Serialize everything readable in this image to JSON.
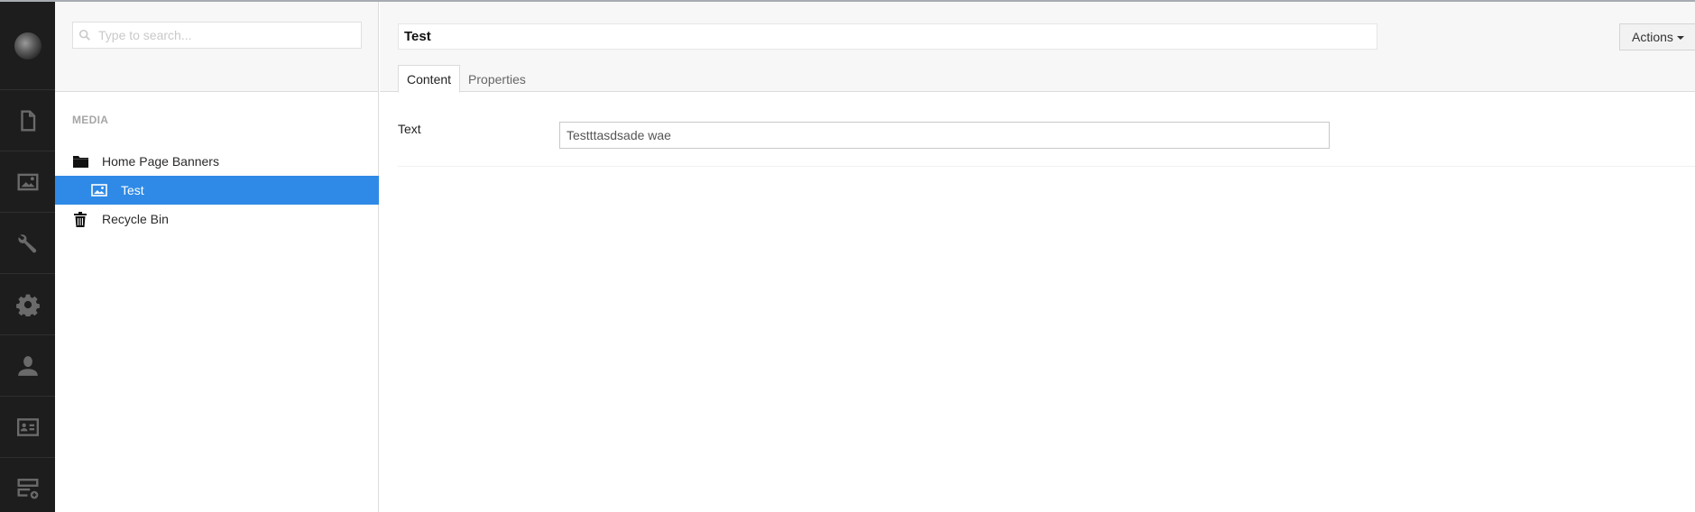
{
  "app_nav": {
    "items": [
      {
        "name": "content",
        "icon": "document-icon"
      },
      {
        "name": "media",
        "icon": "image-icon"
      },
      {
        "name": "settings",
        "icon": "wrench-icon"
      },
      {
        "name": "developer",
        "icon": "gear-icon"
      },
      {
        "name": "users",
        "icon": "user-icon"
      },
      {
        "name": "members",
        "icon": "id-card-icon"
      },
      {
        "name": "forms",
        "icon": "add-form-icon"
      }
    ]
  },
  "tree": {
    "search": {
      "placeholder": "Type to search...",
      "value": ""
    },
    "section_title": "MEDIA",
    "items": [
      {
        "label": "Home Page Banners",
        "icon": "folder-icon",
        "level": 0
      },
      {
        "label": "Test",
        "icon": "image-icon",
        "level": 1,
        "selected": true
      },
      {
        "label": "Recycle Bin",
        "icon": "trash-icon",
        "level": 0
      }
    ]
  },
  "editor": {
    "name_value": "Test",
    "actions_label": "Actions",
    "tabs": [
      {
        "label": "Content",
        "active": true
      },
      {
        "label": "Properties",
        "active": false
      }
    ],
    "properties": [
      {
        "label": "Text",
        "value": "Testttasdsade wae"
      }
    ]
  },
  "colors": {
    "accent": "#2e8ae6",
    "nav_bg": "#1d1d1d",
    "header_bg": "#f7f7f7"
  }
}
